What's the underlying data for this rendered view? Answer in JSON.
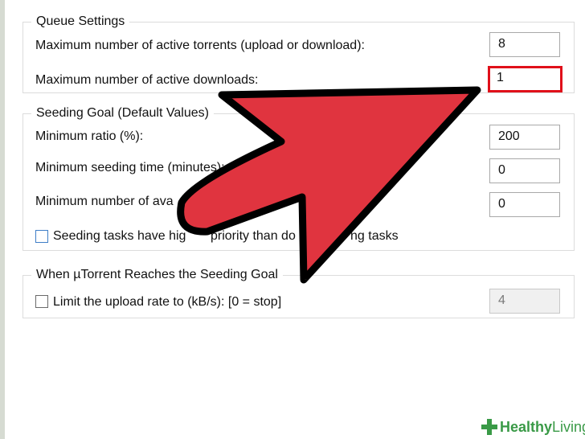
{
  "queue_settings": {
    "legend": "Queue Settings",
    "max_active_torrents_label": "Maximum number of active torrents (upload or download):",
    "max_active_torrents_value": "8",
    "max_active_downloads_label": "Maximum number of active downloads:",
    "max_active_downloads_value": "1"
  },
  "seeding_goal": {
    "legend": "Seeding Goal (Default Values)",
    "min_ratio_label": "Minimum ratio (%):",
    "min_ratio_value": "200",
    "min_seeding_time_label": "Minimum seeding time (minutes):",
    "min_seeding_time_value": "0",
    "min_available_label": "Minimum number of ava",
    "min_available_value": "0",
    "priority_checkbox_label_part1": "Seeding tasks have hig",
    "priority_checkbox_label_part2": "priority than do",
    "priority_checkbox_label_part3": "ng tasks",
    "priority_checked": false
  },
  "reaches_goal": {
    "legend": "When µTorrent Reaches the Seeding Goal",
    "limit_upload_label": "Limit the upload rate to (kB/s): [0 = stop]",
    "limit_upload_checked": false,
    "limit_upload_value": "4"
  },
  "colors": {
    "arrow_fill": "#e0343f",
    "arrow_outline": "#000000",
    "highlight_border": "#e0101a",
    "watermark_green": "#3a9a47"
  },
  "watermark": {
    "brand_a": "Healthy",
    "brand_b": "Living"
  }
}
